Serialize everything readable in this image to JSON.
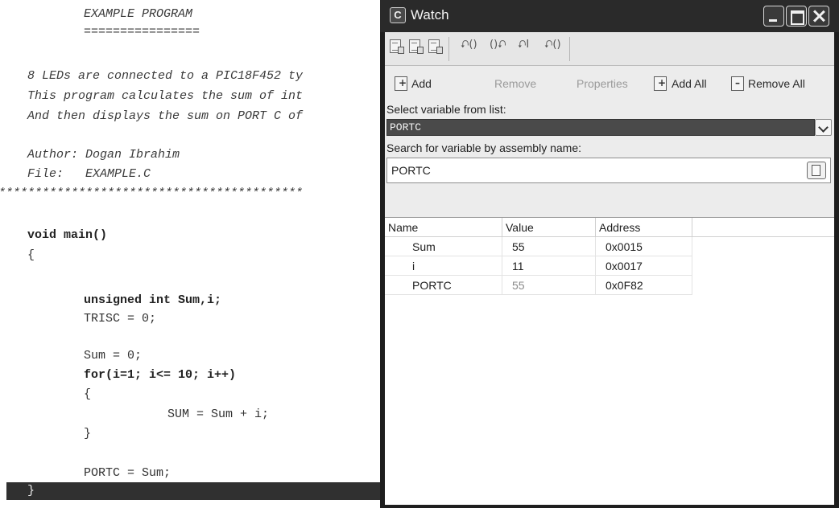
{
  "editor": {
    "lines": [
      {
        "text": "EXAMPLE PROGRAM",
        "style": "comment"
      },
      {
        "text": "================",
        "style": "comment"
      },
      {
        "text": "8 LEDs are connected to a PIC18F452 ty",
        "style": "comment"
      },
      {
        "text": "This program calculates the sum of int",
        "style": "comment"
      },
      {
        "text": "And then displays the sum on PORT C of",
        "style": "comment"
      },
      {
        "text": "Author: Dogan Ibrahim",
        "style": "comment"
      },
      {
        "text": "File:   EXAMPLE.C",
        "style": "comment"
      },
      {
        "text": "******************************************",
        "style": "comment"
      },
      {
        "text": "void main()",
        "style": "bold"
      },
      {
        "text": "{",
        "style": "plain"
      },
      {
        "text": "unsigned int Sum,i;",
        "style": "bold"
      },
      {
        "text": "TRISC = 0;",
        "style": "plain"
      },
      {
        "text": "Sum = 0;",
        "style": "plain"
      },
      {
        "text": "for(i=1; i<= 10; i++)",
        "style": "bold"
      },
      {
        "text": "{",
        "style": "plain"
      },
      {
        "text": "SUM = Sum + i;",
        "style": "plain"
      },
      {
        "text": "}",
        "style": "plain"
      },
      {
        "text": "PORTC = Sum;",
        "style": "plain"
      },
      {
        "text": "}",
        "style": "selected"
      }
    ]
  },
  "watch": {
    "title": "Watch",
    "title_icon_letter": "C",
    "toolbar_icons": [
      "import-icon",
      "export-icon",
      "clear-icon",
      "step-into-icon",
      "step-over-icon",
      "step-out-icon",
      "run-to-cursor-icon"
    ],
    "toolbar_glyphs": [
      "⮏()",
      "()⮏",
      "⮏I",
      "⮏()"
    ],
    "actions": {
      "add": "Add",
      "remove": "Remove",
      "properties": "Properties",
      "add_all": "Add All",
      "remove_all": "Remove All"
    },
    "select_label": "Select variable from list:",
    "select_value": "PORTC",
    "search_label": "Search for variable by assembly name:",
    "search_value": "PORTC",
    "table": {
      "headers": [
        "Name",
        "Value",
        "Address"
      ],
      "rows": [
        {
          "name": "Sum",
          "value": "55",
          "address": "0x0015",
          "value_dim": false
        },
        {
          "name": "i",
          "value": "11",
          "address": "0x0017",
          "value_dim": false
        },
        {
          "name": "PORTC",
          "value": "55",
          "address": "0x0F82",
          "value_dim": true
        }
      ]
    }
  }
}
